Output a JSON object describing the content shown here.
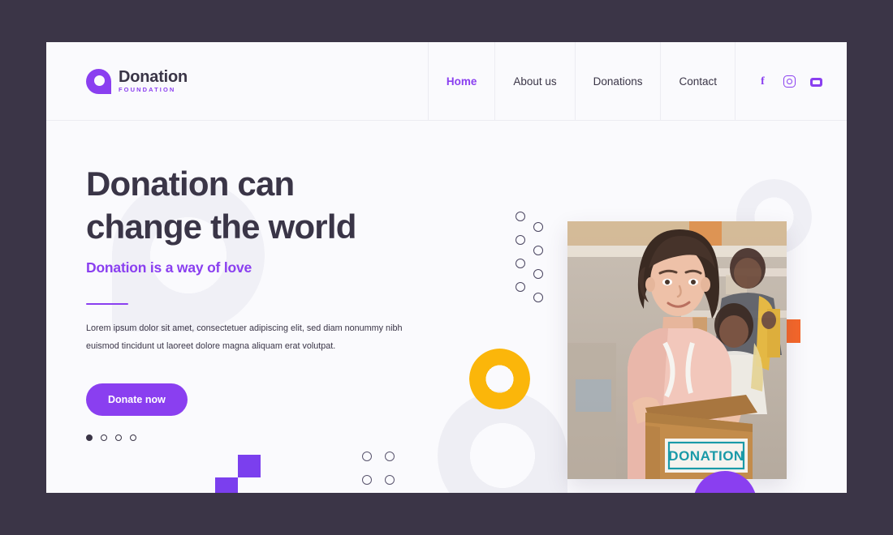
{
  "theme": {
    "background": "#3B3547",
    "card_background": "#FAFAFD",
    "accent_purple": "#8A3FF0",
    "accent_yellow": "#FBB60A",
    "accent_orange": "#F4672A",
    "text_dark": "#3A3547",
    "watermark_gray": "#F0F0F6"
  },
  "header": {
    "brand": {
      "name": "Donation",
      "tagline": "FOUNDATION",
      "logo_icon": "donation-drop-logo"
    },
    "nav": [
      {
        "label": "Home",
        "active": true
      },
      {
        "label": "About us",
        "active": false
      },
      {
        "label": "Donations",
        "active": false
      },
      {
        "label": "Contact",
        "active": false
      }
    ],
    "social": [
      {
        "name": "facebook-icon",
        "glyph": "f"
      },
      {
        "name": "instagram-icon",
        "glyph": ""
      },
      {
        "name": "email-icon",
        "glyph": ""
      }
    ]
  },
  "hero": {
    "headline_line1": "Donation can",
    "headline_line2": "change the world",
    "subhead": "Donation is a way of love",
    "body": "Lorem ipsum dolor sit amet, consectetuer adipiscing elit, sed diam nonummy nibh euismod tincidunt ut laoreet dolore magna aliquam erat volutpat.",
    "cta_label": "Donate now",
    "carousel": {
      "count": 4,
      "active_index": 0
    },
    "photo": {
      "alt": "Volunteer woman holding a donation box",
      "box_label": "DONATION",
      "box_label_color": "#1A9AA8"
    }
  },
  "decor": {
    "dot_grid_count": 8,
    "dots_2x2_count": 4,
    "orange_squares": 3,
    "purple_squares": 2,
    "yellow_ring": true,
    "purple_dome": true,
    "watermark_rings": 3
  }
}
